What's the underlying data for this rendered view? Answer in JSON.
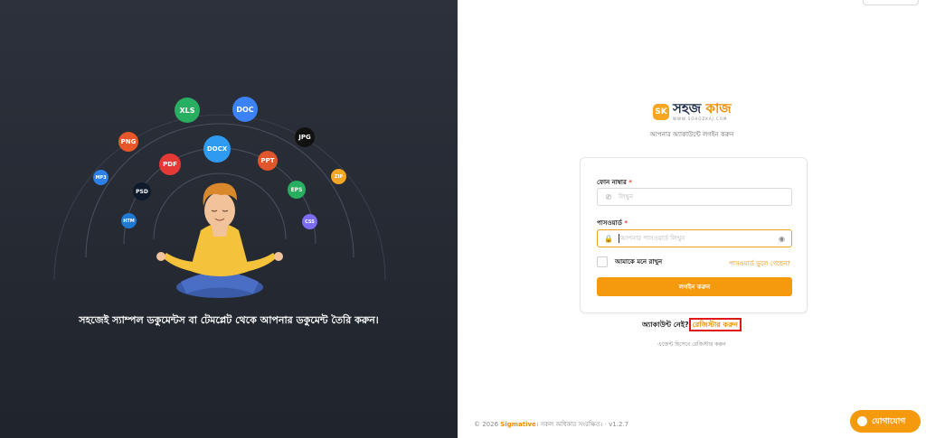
{
  "hero": {
    "tagline": "সহজেই স্যাম্পল ডকুমেন্টস বা টেমপ্লেট থেকে আপনার ডকুমেন্ট তৈরি করুন।",
    "badges": [
      {
        "label": "XLS",
        "color": "#27ae60"
      },
      {
        "label": "DOC",
        "color": "#3b82f6"
      },
      {
        "label": "PNG",
        "color": "#e8572a"
      },
      {
        "label": "JPG",
        "color": "#111111"
      },
      {
        "label": "DOCX",
        "color": "#2f9bf0"
      },
      {
        "label": "PDF",
        "color": "#e53935"
      },
      {
        "label": "PPT",
        "color": "#e0562c"
      },
      {
        "label": "MP3",
        "color": "#2e7fe8"
      },
      {
        "label": "ZIP",
        "color": "#f5a623"
      },
      {
        "label": "PSD",
        "color": "#0f1a2a"
      },
      {
        "label": "EPS",
        "color": "#27ae60"
      },
      {
        "label": "HTM",
        "color": "#1f78d1"
      },
      {
        "label": "CSS",
        "color": "#7c6cf0"
      }
    ]
  },
  "brand": {
    "mark": "SK",
    "name_part1": "সহজ",
    "name_part2": "কাজ",
    "url": "WWW.SOHOZKAJ.COM",
    "subtitle": "আপনার অ্যাকাউন্টে লগইন করুন"
  },
  "form": {
    "phone_label": "ফোন নাম্বার",
    "phone_placeholder": "লিখুন",
    "password_label": "পাসওয়ার্ড",
    "password_placeholder": "আপনার পাসওয়ার্ড লিখুন",
    "required_mark": "*",
    "remember_label": "আমাকে মনে রাখুন",
    "remember_checked": false,
    "forgot_link": "পাসওয়ার্ড ভুলে গেছেন?",
    "login_button": "লগইন করুন"
  },
  "register": {
    "prompt": "অ্যাকাউন্ট নেই?",
    "link": "রেজিস্টার করুন",
    "agent_link": "এজেন্ট হিসেবে রেজিস্টার করুন"
  },
  "footer": {
    "copyright": "© 2026",
    "brand": "Sigmative",
    "rights": "। সকল অধিকার সংরক্ষিত।",
    "separator": "·",
    "version": "v1.2.7"
  },
  "contact_button": "যোগাযোগ",
  "colors": {
    "accent": "#f59a0c",
    "brand_dark": "#1d2b4c",
    "highlight_border": "#e01818"
  }
}
